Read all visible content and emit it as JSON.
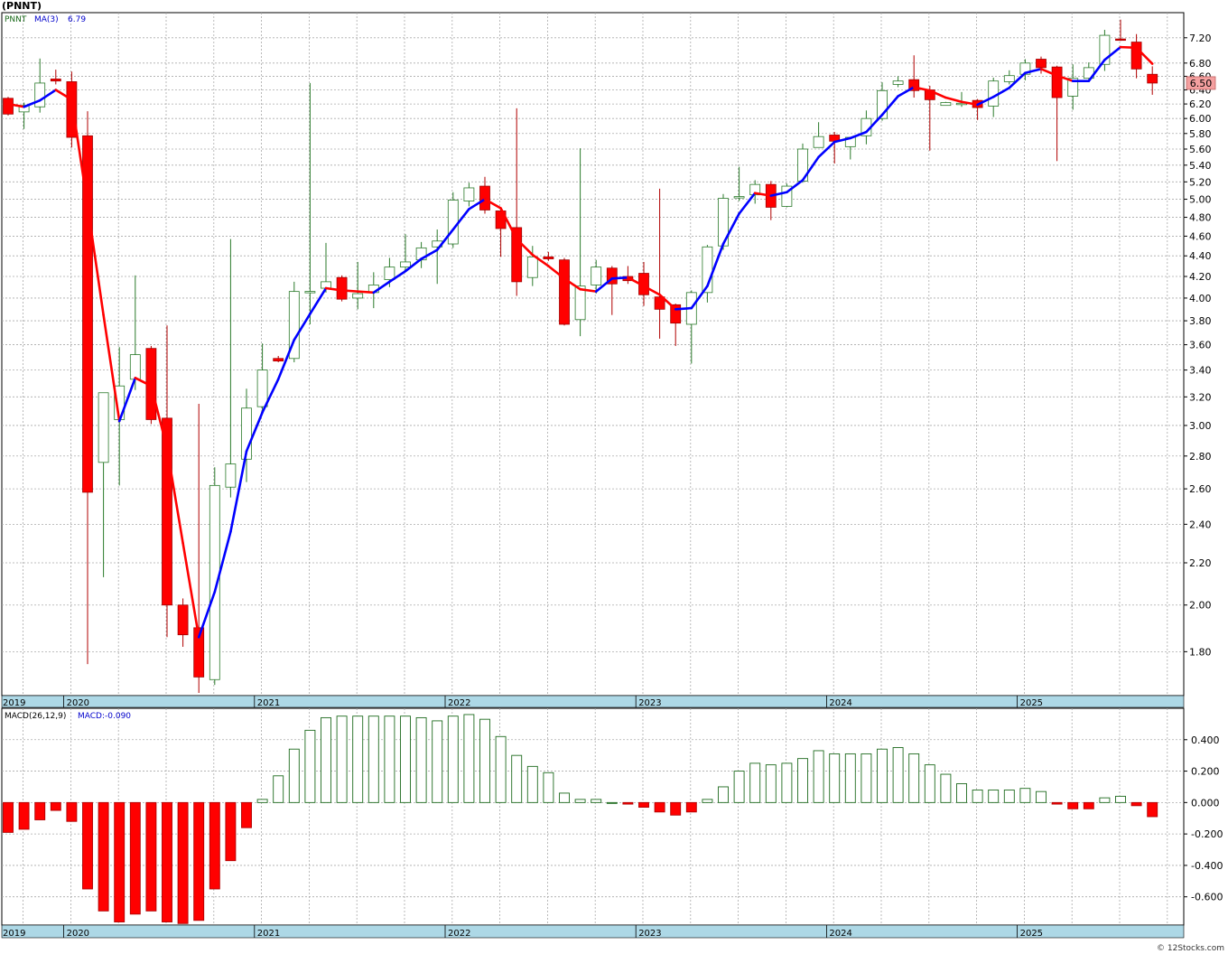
{
  "title": "(PNNT)",
  "watermark": "© 12Stocks.com",
  "colors": {
    "up_candle_border": "#2a7a2a",
    "down_candle": "#ff0000",
    "ma_rising": "#0000ff",
    "ma_falling": "#ff0000",
    "macd_pos": "#1e6b1e",
    "macd_neg": "#ff0000",
    "grid": "#aaaaaa",
    "timeline_band": "#add8e6",
    "last_price_box": "#f4a0a0"
  },
  "chart_data": [
    {
      "type": "candlestick",
      "symbol": "PNNT",
      "ma_label": "MA(3)",
      "ma_value_label": "6.79",
      "last_price_label": "6.50",
      "y_ticks": [
        "1.80",
        "2.00",
        "2.20",
        "2.40",
        "2.60",
        "2.80",
        "3.00",
        "3.20",
        "3.40",
        "3.60",
        "3.80",
        "4.00",
        "4.20",
        "4.40",
        "4.60",
        "4.80",
        "5.00",
        "5.20",
        "5.40",
        "5.60",
        "5.80",
        "6.00",
        "6.20",
        "6.40",
        "6.60",
        "6.80",
        "7.20"
      ],
      "y_scale": "log",
      "ylim": [
        1.63,
        7.62
      ],
      "x_years": [
        "2019",
        "2020",
        "2021",
        "2022",
        "2023",
        "2024",
        "2025"
      ],
      "candles": [
        {
          "o": 6.28,
          "h": 6.3,
          "l": 6.04,
          "c": 6.06
        },
        {
          "o": 6.09,
          "h": 6.22,
          "l": 5.86,
          "c": 6.18
        },
        {
          "o": 6.16,
          "h": 6.87,
          "l": 6.08,
          "c": 6.5
        },
        {
          "o": 6.56,
          "h": 6.7,
          "l": 6.48,
          "c": 6.53
        },
        {
          "o": 6.52,
          "h": 6.67,
          "l": 5.62,
          "c": 5.75
        },
        {
          "o": 5.77,
          "h": 6.1,
          "l": 1.75,
          "c": 2.58
        },
        {
          "o": 2.76,
          "h": 3.23,
          "l": 2.13,
          "c": 3.23
        },
        {
          "o": 3.04,
          "h": 3.58,
          "l": 2.62,
          "c": 3.28
        },
        {
          "o": 3.33,
          "h": 4.21,
          "l": 3.25,
          "c": 3.52
        },
        {
          "o": 3.57,
          "h": 3.59,
          "l": 3.01,
          "c": 3.04
        },
        {
          "o": 3.05,
          "h": 3.76,
          "l": 1.86,
          "c": 2.0
        },
        {
          "o": 2.0,
          "h": 2.03,
          "l": 1.82,
          "c": 1.87
        },
        {
          "o": 1.9,
          "h": 3.15,
          "l": 1.64,
          "c": 1.7
        },
        {
          "o": 1.69,
          "h": 2.73,
          "l": 1.67,
          "c": 2.62
        },
        {
          "o": 2.61,
          "h": 4.57,
          "l": 2.55,
          "c": 2.75
        },
        {
          "o": 2.78,
          "h": 3.26,
          "l": 2.64,
          "c": 3.12
        },
        {
          "o": 3.13,
          "h": 3.61,
          "l": 3.09,
          "c": 3.4
        },
        {
          "o": 3.49,
          "h": 3.51,
          "l": 3.46,
          "c": 3.47
        },
        {
          "o": 3.49,
          "h": 4.15,
          "l": 3.46,
          "c": 4.06
        },
        {
          "o": 4.05,
          "h": 6.5,
          "l": 3.77,
          "c": 4.06
        },
        {
          "o": 4.09,
          "h": 4.53,
          "l": 4.05,
          "c": 4.15
        },
        {
          "o": 4.19,
          "h": 4.21,
          "l": 3.97,
          "c": 3.99
        },
        {
          "o": 4.0,
          "h": 4.34,
          "l": 3.9,
          "c": 4.04
        },
        {
          "o": 4.05,
          "h": 4.24,
          "l": 3.91,
          "c": 4.12
        },
        {
          "o": 4.17,
          "h": 4.38,
          "l": 4.1,
          "c": 4.29
        },
        {
          "o": 4.29,
          "h": 4.62,
          "l": 4.26,
          "c": 4.34
        },
        {
          "o": 4.36,
          "h": 4.54,
          "l": 4.28,
          "c": 4.48
        },
        {
          "o": 4.49,
          "h": 4.67,
          "l": 4.13,
          "c": 4.55
        },
        {
          "o": 4.52,
          "h": 5.08,
          "l": 4.48,
          "c": 4.99
        },
        {
          "o": 4.98,
          "h": 5.19,
          "l": 4.92,
          "c": 5.13
        },
        {
          "o": 5.15,
          "h": 5.26,
          "l": 4.84,
          "c": 4.88
        },
        {
          "o": 4.87,
          "h": 4.89,
          "l": 4.39,
          "c": 4.68
        },
        {
          "o": 4.69,
          "h": 6.14,
          "l": 4.02,
          "c": 4.15
        },
        {
          "o": 4.19,
          "h": 4.5,
          "l": 4.11,
          "c": 4.39
        },
        {
          "o": 4.39,
          "h": 4.44,
          "l": 4.35,
          "c": 4.37
        },
        {
          "o": 4.36,
          "h": 4.38,
          "l": 3.76,
          "c": 3.77
        },
        {
          "o": 3.81,
          "h": 5.61,
          "l": 3.67,
          "c": 4.11
        },
        {
          "o": 4.12,
          "h": 4.36,
          "l": 4.04,
          "c": 4.29
        },
        {
          "o": 4.28,
          "h": 4.3,
          "l": 3.85,
          "c": 4.13
        },
        {
          "o": 4.2,
          "h": 4.3,
          "l": 4.13,
          "c": 4.16
        },
        {
          "o": 4.23,
          "h": 4.34,
          "l": 3.93,
          "c": 4.03
        },
        {
          "o": 4.01,
          "h": 5.12,
          "l": 3.65,
          "c": 3.9
        },
        {
          "o": 3.94,
          "h": 3.95,
          "l": 3.59,
          "c": 3.78
        },
        {
          "o": 3.77,
          "h": 4.07,
          "l": 3.45,
          "c": 4.05
        },
        {
          "o": 4.05,
          "h": 4.51,
          "l": 3.96,
          "c": 4.49
        },
        {
          "o": 4.5,
          "h": 5.06,
          "l": 4.46,
          "c": 5.01
        },
        {
          "o": 5.02,
          "h": 5.38,
          "l": 4.98,
          "c": 5.03
        },
        {
          "o": 5.05,
          "h": 5.22,
          "l": 4.95,
          "c": 5.17
        },
        {
          "o": 5.17,
          "h": 5.21,
          "l": 4.77,
          "c": 4.91
        },
        {
          "o": 4.92,
          "h": 5.18,
          "l": 4.91,
          "c": 5.15
        },
        {
          "o": 5.21,
          "h": 5.67,
          "l": 5.19,
          "c": 5.6
        },
        {
          "o": 5.62,
          "h": 5.95,
          "l": 5.62,
          "c": 5.76
        },
        {
          "o": 5.78,
          "h": 5.82,
          "l": 5.42,
          "c": 5.7
        },
        {
          "o": 5.63,
          "h": 5.72,
          "l": 5.47,
          "c": 5.75
        },
        {
          "o": 5.77,
          "h": 6.11,
          "l": 5.66,
          "c": 6.0
        },
        {
          "o": 6.0,
          "h": 6.51,
          "l": 5.97,
          "c": 6.39
        },
        {
          "o": 6.48,
          "h": 6.6,
          "l": 6.44,
          "c": 6.53
        },
        {
          "o": 6.55,
          "h": 6.92,
          "l": 6.29,
          "c": 6.39
        },
        {
          "o": 6.4,
          "h": 6.46,
          "l": 5.58,
          "c": 6.26
        },
        {
          "o": 6.18,
          "h": 6.23,
          "l": 6.18,
          "c": 6.22
        },
        {
          "o": 6.21,
          "h": 6.37,
          "l": 6.16,
          "c": 6.21
        },
        {
          "o": 6.25,
          "h": 6.27,
          "l": 5.98,
          "c": 6.15
        },
        {
          "o": 6.17,
          "h": 6.58,
          "l": 6.02,
          "c": 6.53
        },
        {
          "o": 6.52,
          "h": 6.69,
          "l": 6.48,
          "c": 6.61
        },
        {
          "o": 6.63,
          "h": 6.86,
          "l": 6.54,
          "c": 6.8
        },
        {
          "o": 6.86,
          "h": 6.9,
          "l": 6.64,
          "c": 6.73
        },
        {
          "o": 6.74,
          "h": 6.76,
          "l": 5.45,
          "c": 6.29
        },
        {
          "o": 6.31,
          "h": 6.78,
          "l": 6.12,
          "c": 6.57
        },
        {
          "o": 6.57,
          "h": 6.81,
          "l": 6.52,
          "c": 6.73
        },
        {
          "o": 6.78,
          "h": 7.33,
          "l": 6.68,
          "c": 7.24
        },
        {
          "o": 7.18,
          "h": 7.5,
          "l": 7.15,
          "c": 7.17
        },
        {
          "o": 7.13,
          "h": 7.26,
          "l": 6.57,
          "c": 6.71
        },
        {
          "o": 6.63,
          "h": 6.75,
          "l": 6.33,
          "c": 6.5
        }
      ],
      "ma3": [
        6.2,
        6.16,
        6.25,
        6.4,
        6.26,
        4.93,
        3.85,
        3.03,
        3.34,
        3.28,
        2.85,
        2.3,
        1.86,
        2.06,
        2.36,
        2.83,
        3.09,
        3.33,
        3.64,
        3.86,
        4.09,
        4.07,
        4.06,
        4.05,
        4.15,
        4.25,
        4.37,
        4.46,
        4.67,
        4.89,
        5.0,
        4.9,
        4.57,
        4.41,
        4.3,
        4.18,
        4.08,
        4.06,
        4.18,
        4.19,
        4.11,
        4.03,
        3.9,
        3.91,
        4.11,
        4.52,
        4.84,
        5.07,
        5.04,
        5.08,
        5.22,
        5.5,
        5.69,
        5.74,
        5.82,
        6.05,
        6.31,
        6.44,
        6.39,
        6.29,
        6.23,
        6.19,
        6.3,
        6.43,
        6.65,
        6.71,
        6.61,
        6.53,
        6.53,
        6.85,
        7.05,
        7.04,
        6.79
      ],
      "macd_label": "MACD(26,12,9)",
      "macd_value_label": "MACD:-0.090",
      "macd_ticks": [
        "0.400",
        "0.200",
        "0.000",
        "-0.200",
        "-0.400",
        "-0.600"
      ],
      "macd_ylim": [
        -0.78,
        0.6
      ],
      "macd": [
        -0.19,
        -0.17,
        -0.11,
        -0.05,
        -0.12,
        -0.55,
        -0.69,
        -0.76,
        -0.71,
        -0.69,
        -0.76,
        -0.77,
        -0.75,
        -0.55,
        -0.37,
        -0.16,
        0.02,
        0.17,
        0.34,
        0.46,
        0.54,
        0.55,
        0.55,
        0.55,
        0.55,
        0.55,
        0.54,
        0.52,
        0.55,
        0.56,
        0.53,
        0.42,
        0.3,
        0.23,
        0.19,
        0.06,
        0.02,
        0.02,
        0.0,
        -0.01,
        -0.03,
        -0.06,
        -0.08,
        -0.06,
        0.02,
        0.1,
        0.2,
        0.25,
        0.24,
        0.25,
        0.28,
        0.33,
        0.31,
        0.31,
        0.31,
        0.34,
        0.35,
        0.31,
        0.24,
        0.18,
        0.12,
        0.08,
        0.08,
        0.08,
        0.09,
        0.07,
        -0.01,
        -0.04,
        -0.04,
        0.03,
        0.04,
        -0.02,
        -0.09
      ]
    }
  ]
}
